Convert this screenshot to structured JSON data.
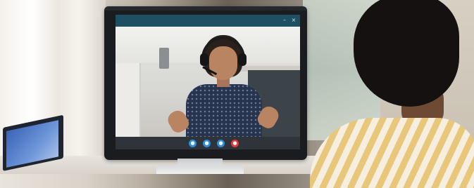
{
  "scene": {
    "description_icons": {
      "minimize": "minimize-icon",
      "close": "close-icon"
    },
    "toolbar_icons": [
      "camera-icon",
      "chat-icon",
      "share-icon",
      "end-call-icon"
    ],
    "colors": {
      "titlebar": "#1f4f63",
      "toolbar_button": "#2f8fd6",
      "end_call_button": "#e23a3a"
    }
  }
}
